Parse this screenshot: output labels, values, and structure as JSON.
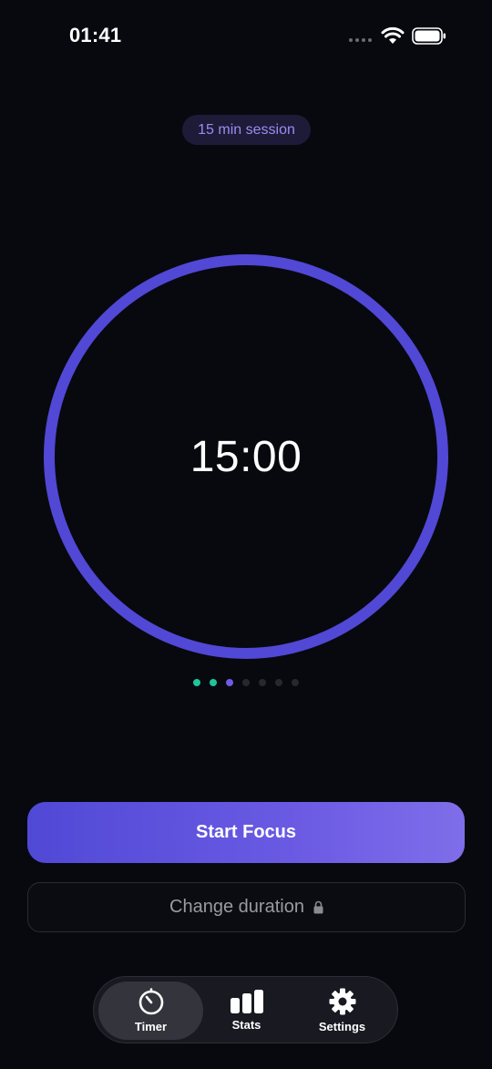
{
  "status_bar": {
    "time": "01:41"
  },
  "session": {
    "badge_label": "15 min session"
  },
  "timer": {
    "display": "15:00",
    "ring_color": "#5148d6",
    "progress": 1.0
  },
  "progress_dots": [
    {
      "state": "completed",
      "color": "#1fc49a"
    },
    {
      "state": "completed",
      "color": "#1fc49a"
    },
    {
      "state": "current",
      "color": "#6c5ce7"
    },
    {
      "state": "pending",
      "color": "#262731"
    },
    {
      "state": "pending",
      "color": "#262731"
    },
    {
      "state": "pending",
      "color": "#262731"
    },
    {
      "state": "pending",
      "color": "#262731"
    }
  ],
  "actions": {
    "start_label": "Start Focus",
    "change_duration_label": "Change duration",
    "change_duration_icon": "lock-icon"
  },
  "tab_bar": {
    "items": [
      {
        "label": "Timer",
        "icon": "stopwatch-icon",
        "active": true
      },
      {
        "label": "Stats",
        "icon": "bar-chart-icon",
        "active": false
      },
      {
        "label": "Settings",
        "icon": "gear-icon",
        "active": false
      }
    ]
  },
  "colors": {
    "background": "#08090f",
    "accent": "#5b4fe0",
    "accent_light": "#9b8cf2",
    "success": "#1fc49a"
  }
}
